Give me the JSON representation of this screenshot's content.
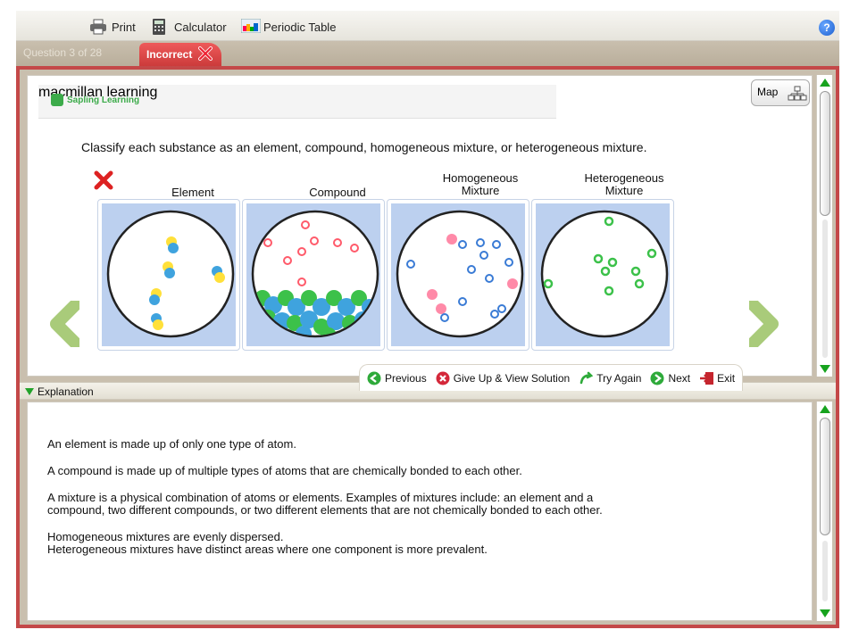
{
  "toolbar": {
    "print_label": "Print",
    "calculator_label": "Calculator",
    "periodic_label": "Periodic Table",
    "help_label": "?"
  },
  "tabs": {
    "question_label": "Question 3 of 28",
    "status_label": "Incorrect"
  },
  "brand": {
    "name": "Sapling Learning",
    "sub": "macmillan learning",
    "color": "#3cab4a"
  },
  "map_label": "Map",
  "question_text": "Classify each substance as an element, compound, homogeneous mixture, or heterogeneous mixture.",
  "columns": [
    {
      "line1": "Element",
      "line2": ""
    },
    {
      "line1": "Compound",
      "line2": ""
    },
    {
      "line1": "Homogeneous",
      "line2": "Mixture"
    },
    {
      "line1": "Heterogeneous",
      "line2": "Mixture"
    }
  ],
  "actions": {
    "previous": "Previous",
    "give_up": "Give Up & View Solution",
    "try_again": "Try Again",
    "next": "Next",
    "exit": "Exit"
  },
  "explanation_label": "Explanation",
  "explanation": {
    "p1": "An element is made up of only one type of atom.",
    "p2": "A compound is made up of multiple types of atoms that are chemically bonded to each other.",
    "p3a": "A mixture is a physical combination of atoms or elements. Examples of mixtures include: an element and a",
    "p3b": "compound, two different compounds, or two different elements that are not chemically bonded to each other.",
    "p4a": "Homogeneous mixtures are evenly dispersed.",
    "p4b": "Heterogeneous mixtures have distinct areas where one component is more prevalent."
  },
  "colors": {
    "frame": "#c44848",
    "incorrect_tab": "#dd4444",
    "accent_green": "#17a31e",
    "card_fill": "#bcd0ef"
  }
}
